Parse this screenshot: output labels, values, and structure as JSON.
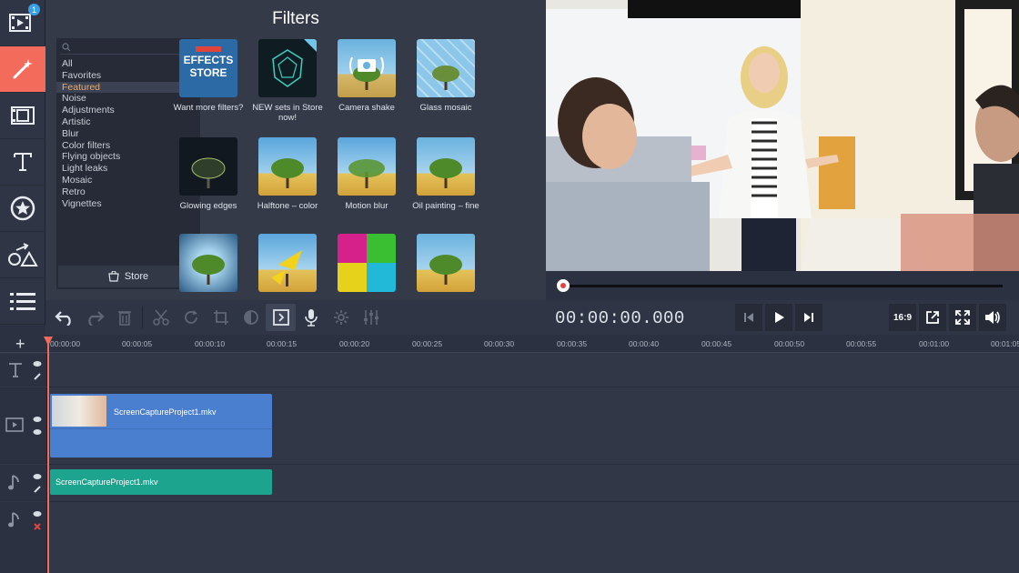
{
  "sidebar": {
    "badge": "1",
    "items": [
      {
        "icon": "import-media-icon"
      },
      {
        "icon": "magic-wand-icon",
        "active": true
      },
      {
        "icon": "film-transitions-icon"
      },
      {
        "icon": "text-titles-icon"
      },
      {
        "icon": "stickers-icon"
      },
      {
        "icon": "shapes-callouts-icon"
      },
      {
        "icon": "more-tools-icon"
      }
    ]
  },
  "filters": {
    "title": "Filters",
    "categories": [
      "All",
      "Favorites",
      "Featured",
      "Noise",
      "Adjustments",
      "Artistic",
      "Blur",
      "Color filters",
      "Flying objects",
      "Light leaks",
      "Mosaic",
      "Retro",
      "Vignettes"
    ],
    "active_category": "Featured",
    "store_label": "Store",
    "store_tile_text_1": "EFFECTS",
    "store_tile_text_2": "STORE",
    "tiles": [
      {
        "label": "Want more filters?"
      },
      {
        "label": "NEW sets in Store now!"
      },
      {
        "label": "Camera shake"
      },
      {
        "label": "Glass mosaic"
      },
      {
        "label": "Glowing edges"
      },
      {
        "label": "Halftone – color"
      },
      {
        "label": "Motion blur"
      },
      {
        "label": "Oil painting – fine"
      },
      {
        "label": ""
      },
      {
        "label": ""
      },
      {
        "label": ""
      },
      {
        "label": ""
      }
    ]
  },
  "player": {
    "timecode": "00:00:00.000",
    "aspect_ratio": "16:9"
  },
  "timeline": {
    "ruler": [
      "00:00:00",
      "00:00:05",
      "00:00:10",
      "00:00:15",
      "00:00:20",
      "00:00:25",
      "00:00:30",
      "00:00:35",
      "00:00:40",
      "00:00:45",
      "00:00:50",
      "00:00:55",
      "00:01:00",
      "00:01:05"
    ],
    "video_clip_name": "ScreenCaptureProject1.mkv",
    "audio_clip_name": "ScreenCaptureProject1.mkv"
  },
  "colors": {
    "accent": "#f26b5b",
    "video_clip": "#4a7fd0",
    "audio_clip": "#1da48f",
    "active_category": "#f5a85f"
  }
}
